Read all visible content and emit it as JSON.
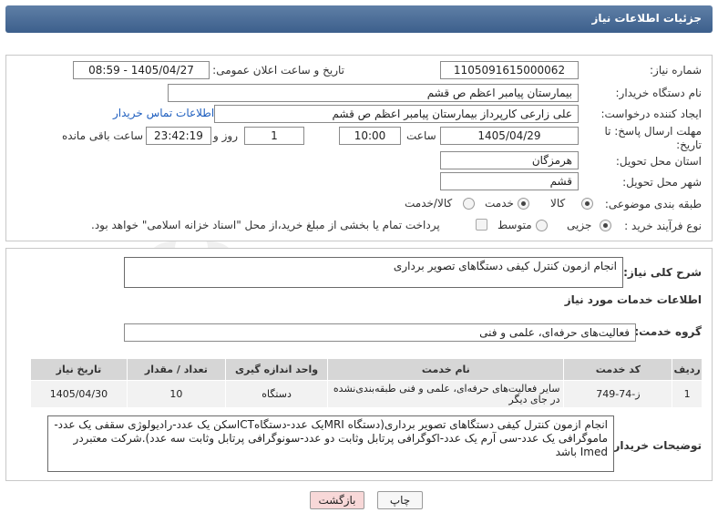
{
  "header": {
    "title": "جزئیات اطلاعات نیاز"
  },
  "form": {
    "need_number_label": "شماره نیاز:",
    "need_number": "1105091615000062",
    "announce_label": "تاریخ و ساعت اعلان عمومی:",
    "announce_value": "1405/04/27 - 08:59",
    "buyer_org_label": "نام دستگاه خریدار:",
    "buyer_org": "بیمارستان پیامبر اعظم  ص  قشم",
    "creator_label": "ایجاد کننده درخواست:",
    "creator": "علی زارعی کارپرداز بیمارستان پیامبر اعظم  ص  قشم",
    "contact_link": "اطلاعات تماس خریدار",
    "deadline_label": "مهلت ارسال پاسخ: تا تاریخ:",
    "deadline_date": "1405/04/29",
    "time_label": "ساعت",
    "deadline_time": "10:00",
    "days_value": "1",
    "days_label": "روز و",
    "remaining_time": "23:42:19",
    "remaining_label": "ساعت باقی مانده",
    "province_label": "استان محل تحویل:",
    "province": "هرمزگان",
    "city_label": "شهر محل تحویل:",
    "city": "قشم",
    "category_label": "طبقه بندی موضوعی:",
    "category_options": [
      "کالا",
      "خدمت",
      "کالا/خدمت"
    ],
    "category_selected": "خدمت",
    "process_label": "نوع فرآیند خرید :",
    "process_options": [
      "جزیی",
      "متوسط"
    ],
    "process_selected": "جزیی",
    "payment_note": "پرداخت تمام یا بخشی از مبلغ خرید،از محل \"اسناد خزانه اسلامی\" خواهد بود."
  },
  "summary": {
    "label": "شرح کلی نیاز:",
    "value": "انجام ازمون کنترل کیفی دستگاهای تصویر برداری"
  },
  "services": {
    "section_title": "اطلاعات خدمات مورد نیاز",
    "group_label": "گروه خدمت:",
    "group_value": "فعالیت‌های حرفه‌ای، علمی و فنی",
    "columns": [
      "ردیف",
      "کد خدمت",
      "نام خدمت",
      "واحد اندازه گیری",
      "تعداد / مقدار",
      "تاریخ نیاز"
    ],
    "rows": [
      [
        "1",
        "ز-74-749",
        "سایر فعالیت‌های حرفه‌ای، علمی و فنی طبقه‌بندی‌نشده در جای دیگر",
        "دستگاه",
        "10",
        "1405/04/30"
      ]
    ]
  },
  "buyer_notes": {
    "label": "توضیحات خریدار:",
    "value": "انجام ازمون کنترل کیفی دستگاهای تصویر برداری(دستگاه MRIیک عدد-دستگاهCTاسکن یک عدد-رادیولوژی سقفی یک عدد-ماموگرافی یک عدد-سی آرم یک عدد-اکوگرافی پرتابل وثابت دو عدد-سونوگرافی پرتابل وثابت سه عدد).شرکت معتبردر Imed باشد"
  },
  "buttons": {
    "print": "چاپ",
    "back": "بازگشت"
  },
  "watermark": {
    "text": "AriaTender.neT"
  },
  "colors": {
    "title_bg": "#4a6d99",
    "link": "#1f5fbf",
    "back_btn": "#f8d8d8",
    "print_btn": "#f7f7f7"
  }
}
